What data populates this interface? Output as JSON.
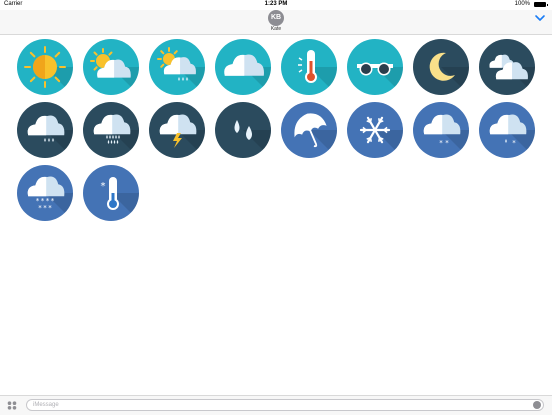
{
  "status_bar": {
    "carrier": "Carrier",
    "time": "1:23 PM",
    "battery": "100%",
    "battery_level": 1.0
  },
  "header": {
    "avatar_initials": "KB",
    "contact_name": "Kate"
  },
  "stickers": [
    {
      "name": "sun-sticker",
      "bg": "#22b3c4",
      "icon": "sun"
    },
    {
      "name": "partly-cloudy-sticker",
      "bg": "#22b3c4",
      "icon": "sun-cloud"
    },
    {
      "name": "sun-cloud-rain-sticker",
      "bg": "#22b3c4",
      "icon": "sun-cloud-rain"
    },
    {
      "name": "cloud-sticker",
      "bg": "#22b3c4",
      "icon": "cloud"
    },
    {
      "name": "thermometer-hot-sticker",
      "bg": "#22b3c4",
      "icon": "thermo-hot"
    },
    {
      "name": "sunglasses-sticker",
      "bg": "#22b3c4",
      "icon": "sunglasses"
    },
    {
      "name": "moon-sticker",
      "bg": "#2b4b5e",
      "icon": "moon"
    },
    {
      "name": "clouds-night-sticker",
      "bg": "#2b4b5e",
      "icon": "two-clouds"
    },
    {
      "name": "cloud-rain-sticker",
      "bg": "#2b4b5e",
      "icon": "cloud-rain"
    },
    {
      "name": "cloud-heavy-rain-sticker",
      "bg": "#2b4b5e",
      "icon": "cloud-heavy-rain"
    },
    {
      "name": "thunderstorm-sticker",
      "bg": "#2b4b5e",
      "icon": "cloud-lightning"
    },
    {
      "name": "raindrops-sticker",
      "bg": "#2b4b5e",
      "icon": "drops"
    },
    {
      "name": "umbrella-sticker",
      "bg": "#4473b5",
      "icon": "umbrella"
    },
    {
      "name": "snowflake-sticker",
      "bg": "#4473b5",
      "icon": "snowflake"
    },
    {
      "name": "cloud-snow-sticker",
      "bg": "#4473b5",
      "icon": "cloud-snow"
    },
    {
      "name": "cloud-sleet-sticker",
      "bg": "#4473b5",
      "icon": "cloud-sleet"
    },
    {
      "name": "cloud-heavy-snow-sticker",
      "bg": "#4473b5",
      "icon": "cloud-heavy-snow"
    },
    {
      "name": "thermometer-cold-sticker",
      "bg": "#4473b5",
      "icon": "thermo-cold"
    }
  ],
  "input": {
    "placeholder": "iMessage"
  },
  "colors": {
    "accent": "#1a7cf5",
    "cloud_light": "#ffffff",
    "cloud_shade": "#cfe2f1",
    "sun": "#f8c12c",
    "sun_dark": "#f0a51b",
    "thermo_hot": "#e0522c",
    "moon": "#f9e08a"
  }
}
